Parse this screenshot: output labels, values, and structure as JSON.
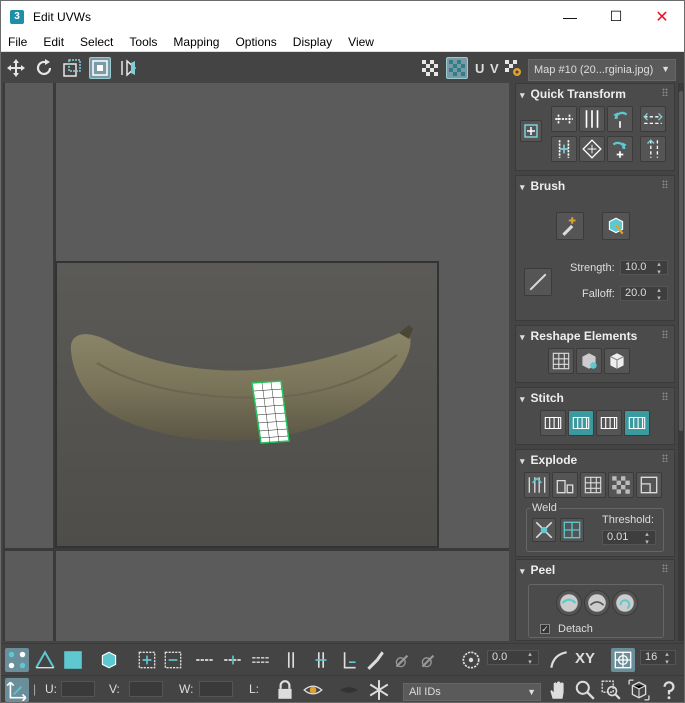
{
  "window": {
    "title": "Edit UVWs",
    "app_icon_text": "3",
    "minimize": "—",
    "maximize": "☐",
    "close": "✕"
  },
  "menu": [
    "File",
    "Edit",
    "Select",
    "Tools",
    "Mapping",
    "Options",
    "Display",
    "View"
  ],
  "toolbar": {
    "uv_label": "U V",
    "map_select": "Map #10 (20...rginia.jpg)"
  },
  "rollouts": {
    "quick_transform": "Quick Transform",
    "brush": {
      "title": "Brush",
      "strength_label": "Strength:",
      "strength_value": "10.0",
      "falloff_label": "Falloff:",
      "falloff_value": "20.0"
    },
    "reshape": "Reshape Elements",
    "stitch": "Stitch",
    "explode": {
      "title": "Explode",
      "weld_label": "Weld",
      "threshold_label": "Threshold:",
      "threshold_value": "0.01"
    },
    "peel": {
      "title": "Peel",
      "detach_label": "Detach",
      "detach_checked": true
    }
  },
  "bottom": {
    "rotate_value": "0.0",
    "xy_label": "XY",
    "grid_value": "16",
    "u_label": "U:",
    "v_label": "V:",
    "w_label": "W:",
    "l_label": "L:",
    "id_select": "All IDs"
  },
  "colors": {
    "accent": "#3a9aa0",
    "viewport_bg": "#5b5b5b",
    "panel_bg": "#444444",
    "uv_edge": "#22c55e"
  }
}
